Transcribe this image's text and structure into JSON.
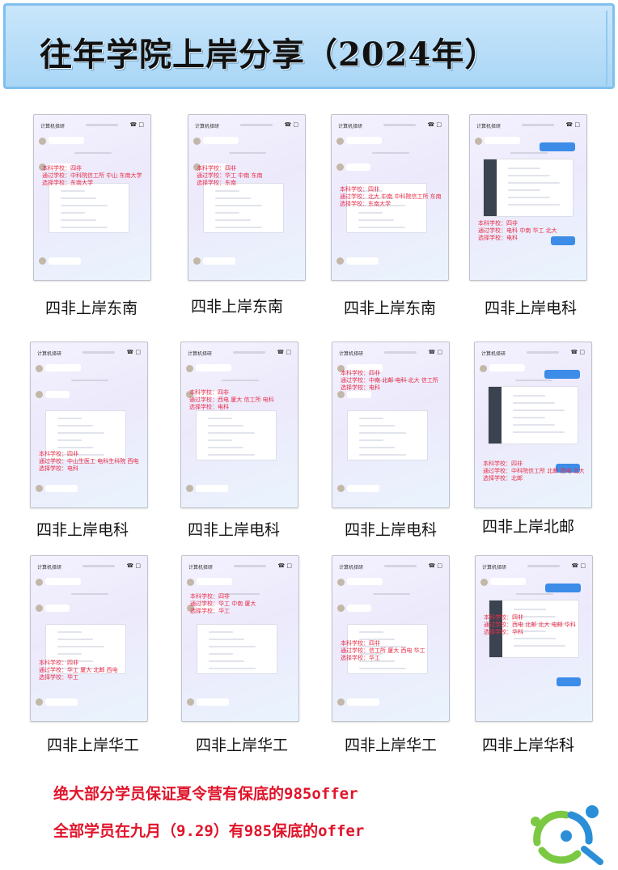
{
  "banner": {
    "title": "往年学院上岸分享（2024年）"
  },
  "panel_template": {
    "header": "计算机择研",
    "undergrad_label": "本科学校：四非",
    "passed_prefix": "通过学校：",
    "chosen_prefix": "选择学校："
  },
  "panels": [
    {
      "caption": "四非上岸东南",
      "passed": "中科院信工所 中山 东南大学",
      "chosen": "东南大学"
    },
    {
      "caption": "四非上岸东南",
      "passed": "华工 中南 东南",
      "chosen": "东南"
    },
    {
      "caption": "四非上岸东南",
      "passed": "北大 中南 中科院信工所 东南",
      "chosen": "东南大学"
    },
    {
      "caption": "四非上岸电科",
      "passed": "电科 中南 华工 北大",
      "chosen": "电科"
    },
    {
      "caption": "四非上岸电科",
      "passed": "中山生医工 电科生科院 西电",
      "chosen": "电科"
    },
    {
      "caption": "四非上岸电科",
      "passed": "西电 厦大 信工所 电科",
      "chosen": "电科"
    },
    {
      "caption": "四非上岸电科",
      "passed": "中南 北邮 电科 北大 信工所",
      "chosen": "电科"
    },
    {
      "caption": "四非上岸北邮",
      "passed": "中科院信工所 北邮 西电 北大",
      "chosen": "北邮"
    },
    {
      "caption": "四非上岸华工",
      "passed": "华工 厦大 北邮 西电",
      "chosen": "华工"
    },
    {
      "caption": "四非上岸华工",
      "passed": "华工 中南 厦大",
      "chosen": "华工"
    },
    {
      "caption": "四非上岸华工",
      "passed": "信工所 厦大 西电 华工",
      "chosen": "华工"
    },
    {
      "caption": "四非上岸华科",
      "passed": "西电 北邮 北大 电邮 华科",
      "chosen": "华科"
    }
  ],
  "footer": {
    "line1": "绝大部分学员保证夏令营有保底的985offer",
    "line2": "全部学员在九月（9.29）有985保底的offer"
  }
}
